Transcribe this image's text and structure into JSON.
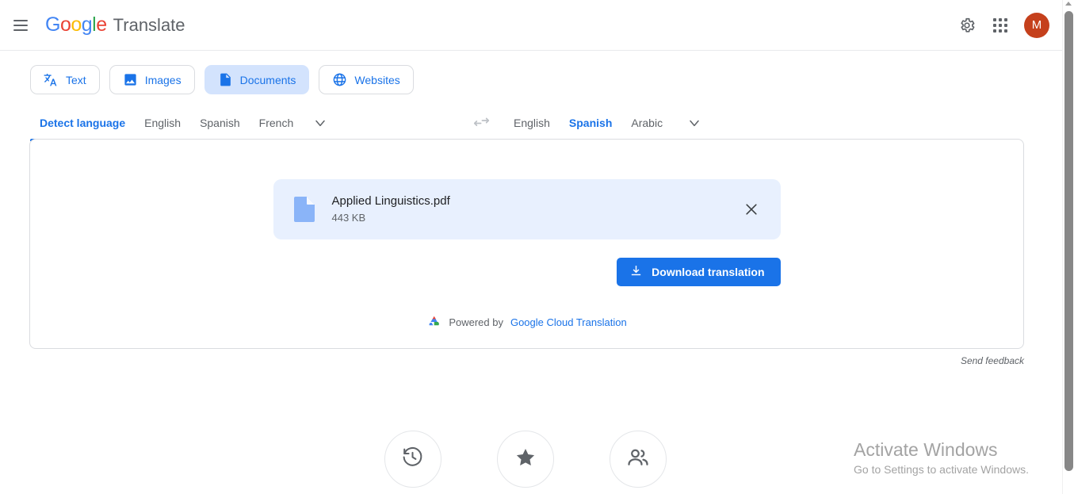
{
  "header": {
    "menu_icon": "hamburger-menu-icon",
    "logo_text": "Google",
    "product_name": "Translate",
    "settings_icon": "gear-icon",
    "apps_icon": "apps-grid-icon",
    "avatar_initial": "M",
    "avatar_color": "#C5401C"
  },
  "mode_tabs": [
    {
      "label": "Text",
      "icon": "translate-icon",
      "active": false
    },
    {
      "label": "Images",
      "icon": "image-icon",
      "active": false
    },
    {
      "label": "Documents",
      "icon": "document-icon",
      "active": true
    },
    {
      "label": "Websites",
      "icon": "globe-icon",
      "active": false
    }
  ],
  "source_languages": {
    "items": [
      {
        "label": "Detect language",
        "active": true
      },
      {
        "label": "English",
        "active": false
      },
      {
        "label": "Spanish",
        "active": false
      },
      {
        "label": "French",
        "active": false
      }
    ],
    "more_icon": "chevron-down-icon"
  },
  "swap_icon": "swap-languages-icon",
  "target_languages": {
    "items": [
      {
        "label": "English",
        "active": false
      },
      {
        "label": "Spanish",
        "active": true
      },
      {
        "label": "Arabic",
        "active": false
      }
    ],
    "more_icon": "chevron-down-icon"
  },
  "document_card": {
    "file_icon": "pdf-file-icon",
    "file_name": "Applied Linguistics.pdf",
    "file_size": "443 KB",
    "remove_icon": "close-icon",
    "card_color": "#e8f0fe"
  },
  "download": {
    "label": "Download translation",
    "icon": "download-icon",
    "color": "#1a73e8"
  },
  "powered_by": {
    "prefix": "Powered by",
    "link_text": "Google Cloud Translation",
    "icon": "google-cloud-icon"
  },
  "feedback": {
    "label": "Send feedback"
  },
  "bottom_actions": [
    {
      "name": "history",
      "icon": "history-icon"
    },
    {
      "name": "saved",
      "icon": "star-icon"
    },
    {
      "name": "contribute",
      "icon": "people-icon"
    }
  ],
  "watermark": {
    "title": "Activate Windows",
    "subtitle": "Go to Settings to activate Windows."
  },
  "colors": {
    "accent_blue": "#1a73e8",
    "active_tab_bg": "#d3e3fd",
    "card_bg": "#e8f0fe",
    "text_primary": "#202124",
    "text_secondary": "#5f6368"
  }
}
